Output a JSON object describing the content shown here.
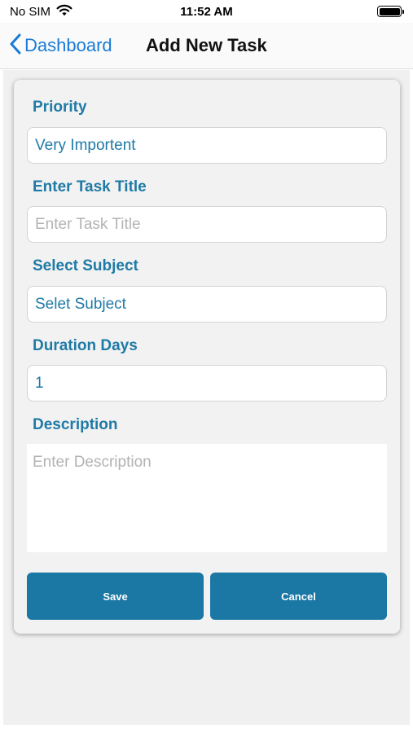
{
  "status_bar": {
    "carrier": "No SIM",
    "time": "11:52 AM"
  },
  "nav": {
    "back_label": "Dashboard",
    "title": "Add New Task"
  },
  "form": {
    "priority": {
      "label": "Priority",
      "value": "Very Importent"
    },
    "task_title": {
      "label": "Enter Task Title",
      "placeholder": "Enter Task Title"
    },
    "subject": {
      "label": "Select Subject",
      "value": "Selet Subject"
    },
    "duration": {
      "label": "Duration Days",
      "value": "1"
    },
    "description": {
      "label": "Description",
      "placeholder": "Enter Description"
    }
  },
  "buttons": {
    "save": "Save",
    "cancel": "Cancel"
  },
  "colors": {
    "accent": "#1b77a4",
    "label": "#1f7aa6",
    "link": "#1a7ad6"
  }
}
